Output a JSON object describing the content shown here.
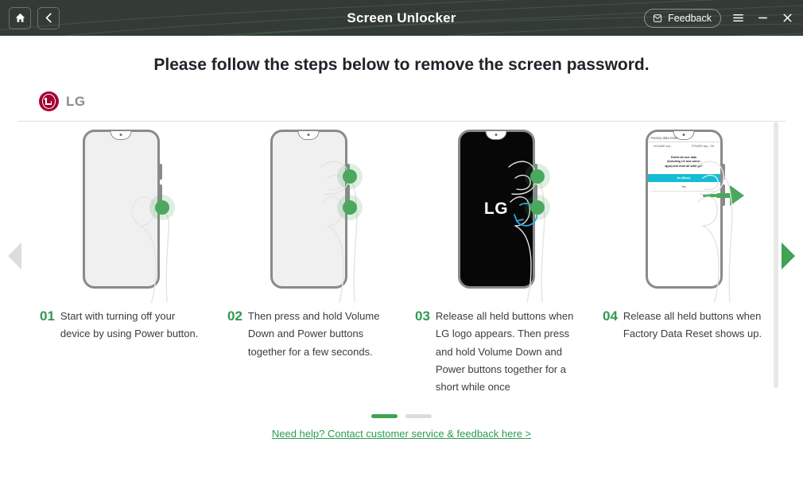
{
  "titlebar": {
    "title": "Screen Unlocker",
    "home_icon": "home-icon",
    "back_icon": "chevron-left-icon",
    "feedback_label": "Feedback",
    "feedback_icon": "envelope-icon",
    "menu_icon": "hamburger-menu-icon",
    "minimize_icon": "minimize-icon",
    "close_icon": "close-icon",
    "background_color": "#343b36"
  },
  "page": {
    "heading": "Please follow the steps below to remove the screen password.",
    "brand": "LG",
    "brand_color": "#a50034",
    "accent_color": "#3ea353"
  },
  "carousel": {
    "prev_arrow": "triangle-left-icon",
    "next_arrow": "triangle-right-icon",
    "prev_enabled": "false",
    "next_enabled": "true"
  },
  "steps": [
    {
      "number": "01",
      "text": "Start with turning off your device by using Power button.",
      "screen": "blank",
      "dots": 1
    },
    {
      "number": "02",
      "text": "Then press and hold Volume Down and Power buttons together for a few seconds.",
      "screen": "blank",
      "dots": 2
    },
    {
      "number": "03",
      "text": "Release all held buttons when LG logo appears. Then press and hold Volume Down and Power buttons together for a short while once",
      "screen": "lg-logo",
      "screen_text": "LG",
      "dots": 2
    },
    {
      "number": "04",
      "text": "Release all held buttons when Factory Data Reset shows up.",
      "screen": "factory-data-reset",
      "dots": 0
    }
  ],
  "factory_reset_screen": {
    "title": "Factory data reset",
    "volume_key": "VOLUME key :",
    "power_key": "POWER key : OK",
    "body_line1": "Delete all user data",
    "body_line2": "(including LG and carrier",
    "body_line3": "apps) and reset all settings?",
    "no_button": "No (Back)",
    "yes_button": "Yes"
  },
  "footer": {
    "page_indicator_active": 1,
    "page_indicator_total": 2,
    "help_link": "Need help? Contact customer service & feedback here >"
  }
}
